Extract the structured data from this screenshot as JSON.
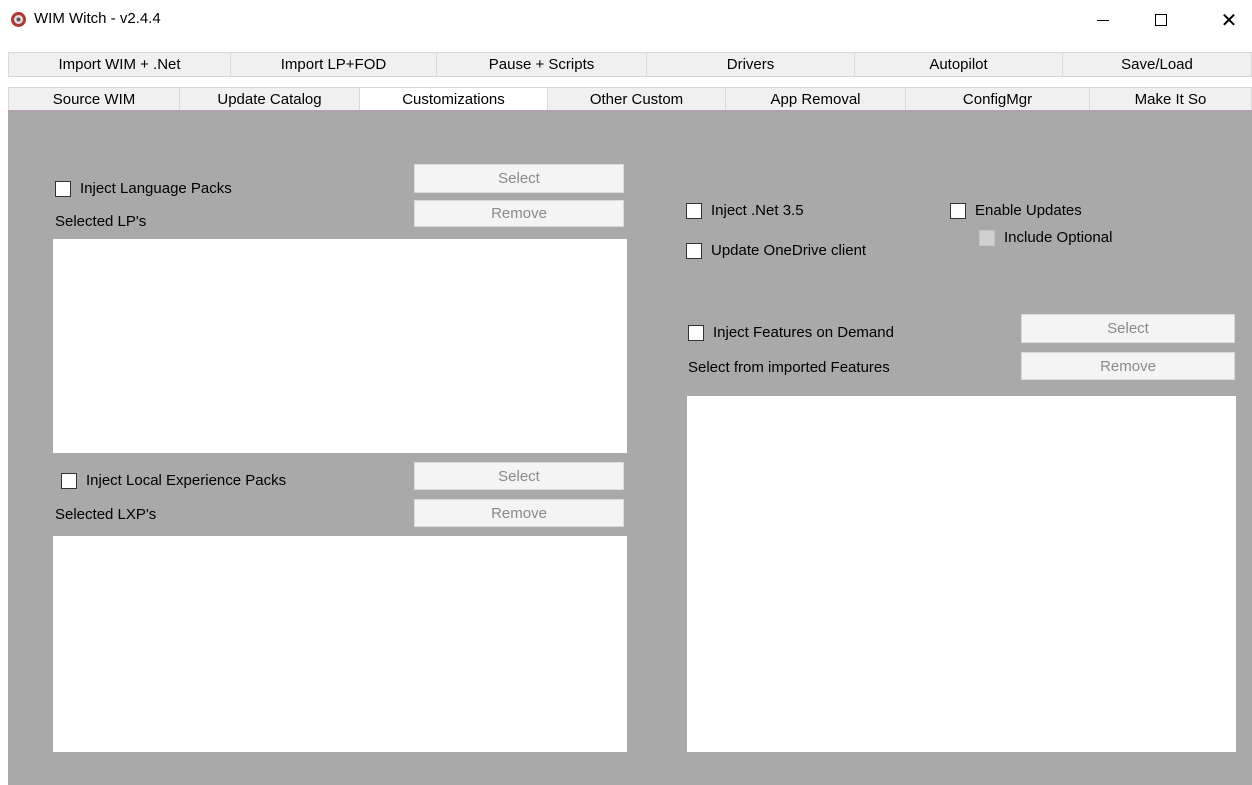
{
  "window": {
    "title": "WIM Witch - v2.4.4",
    "min_glyph": "",
    "max_glyph": "",
    "close_glyph": "✕"
  },
  "tabs": {
    "row1": [
      "Import WIM + .Net",
      "Import LP+FOD",
      "Pause + Scripts",
      "Drivers",
      "Autopilot",
      "Save/Load"
    ],
    "row2": [
      "Source WIM",
      "Update Catalog",
      "Customizations",
      "Other Custom",
      "App Removal",
      "ConfigMgr",
      "Make It So"
    ],
    "selected": "Customizations"
  },
  "lp": {
    "inject_label": "Inject Language Packs",
    "selected_label": "Selected LP's",
    "select_btn": "Select",
    "remove_btn": "Remove"
  },
  "lxp": {
    "inject_label": "Inject Local Experience Packs",
    "selected_label": "Selected LXP's",
    "select_btn": "Select",
    "remove_btn": "Remove"
  },
  "options": {
    "net35": "Inject .Net 3.5",
    "onedrive": "Update OneDrive client",
    "enable_updates": "Enable Updates",
    "include_optional": "Include Optional"
  },
  "fod": {
    "inject_label": "Inject Features on Demand",
    "selected_label": "Select from imported Features",
    "select_btn": "Select",
    "remove_btn": "Remove"
  },
  "colors": {
    "panel_bg": "#a9a9a9",
    "tab_bg": "#f0f0f0",
    "button_text_disabled": "#8a8a8a"
  }
}
